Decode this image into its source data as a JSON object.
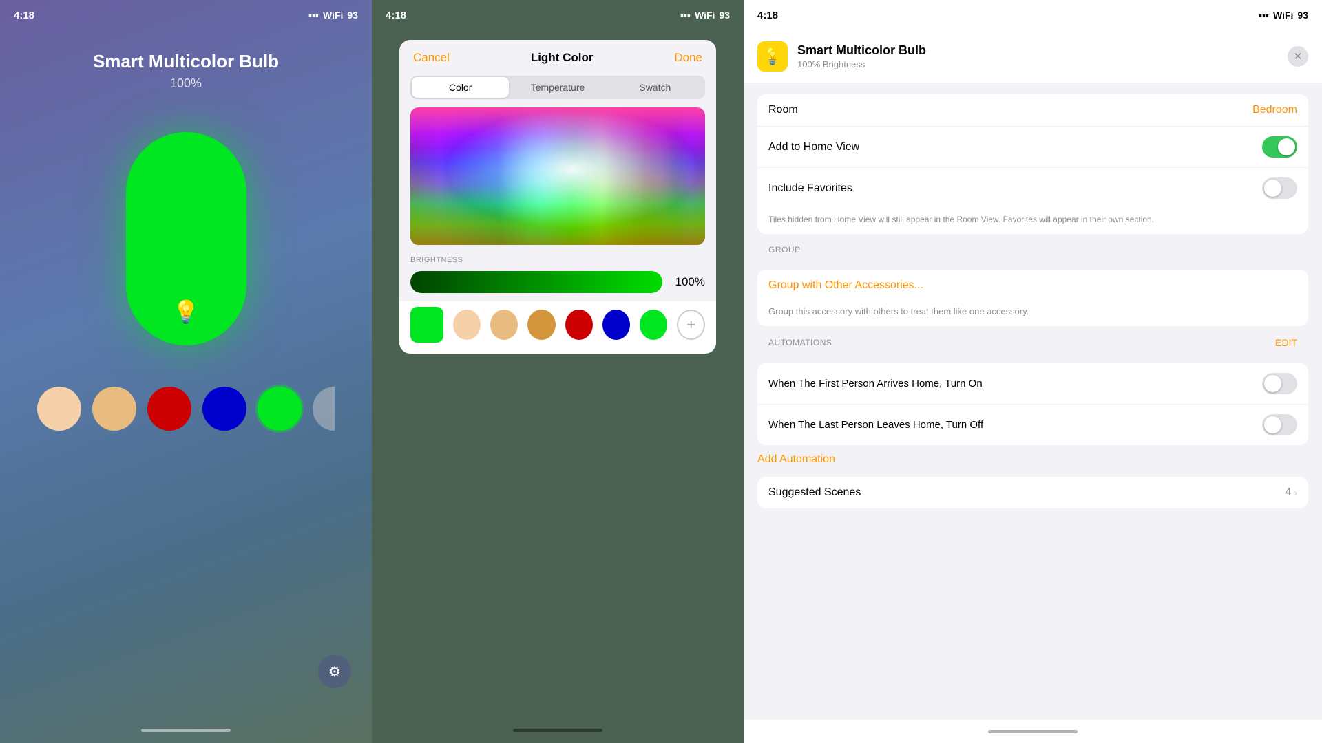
{
  "status_bar": {
    "time": "4:18",
    "battery": "93"
  },
  "panel1": {
    "title": "Smart Multicolor Bulb",
    "brightness": "100%",
    "swatches": [
      {
        "color": "#f5d0a9",
        "label": "warm-white"
      },
      {
        "color": "#e8bc80",
        "label": "warm-yellow"
      },
      {
        "color": "#cc0000",
        "label": "red"
      },
      {
        "color": "#0000cc",
        "label": "blue"
      },
      {
        "color": "#00e620",
        "label": "green",
        "selected": true
      }
    ]
  },
  "panel2": {
    "header": {
      "cancel": "Cancel",
      "title": "Light Color",
      "done": "Done"
    },
    "tabs": [
      {
        "label": "Color",
        "active": true
      },
      {
        "label": "Temperature",
        "active": false
      },
      {
        "label": "Swatch",
        "active": false
      }
    ],
    "brightness_label": "BRIGHTNESS",
    "brightness_value": "100%",
    "presets": [
      {
        "color": "#f5d0a9",
        "shape": "square"
      },
      {
        "color": "#e8bc80",
        "shape": "circle"
      },
      {
        "color": "#d4963c",
        "shape": "circle"
      },
      {
        "color": "#cc0000",
        "shape": "circle"
      },
      {
        "color": "#0000cc",
        "shape": "circle"
      },
      {
        "color": "#00e620",
        "shape": "circle"
      }
    ]
  },
  "panel3": {
    "device_name": "Smart Multicolor Bulb",
    "device_brightness": "100% Brightness",
    "settings": {
      "room_label": "Room",
      "room_value": "Bedroom",
      "add_to_home_label": "Add to Home View",
      "add_to_home_value": true,
      "include_favorites_label": "Include Favorites",
      "include_favorites_value": false,
      "hint_text": "Tiles hidden from Home View will still appear in the Room View. Favorites will appear in their own section."
    },
    "group_section": "GROUP",
    "group_link": "Group with Other Accessories...",
    "group_desc": "Group this accessory with others to treat them like one accessory.",
    "automations_section": "AUTOMATIONS",
    "automations_edit": "EDIT",
    "automation1": "When The First Person Arrives Home, Turn On",
    "automation2": "When The Last Person Leaves Home, Turn Off",
    "add_automation": "Add Automation",
    "suggested_scenes": "Suggested Scenes",
    "suggested_count": "4"
  }
}
